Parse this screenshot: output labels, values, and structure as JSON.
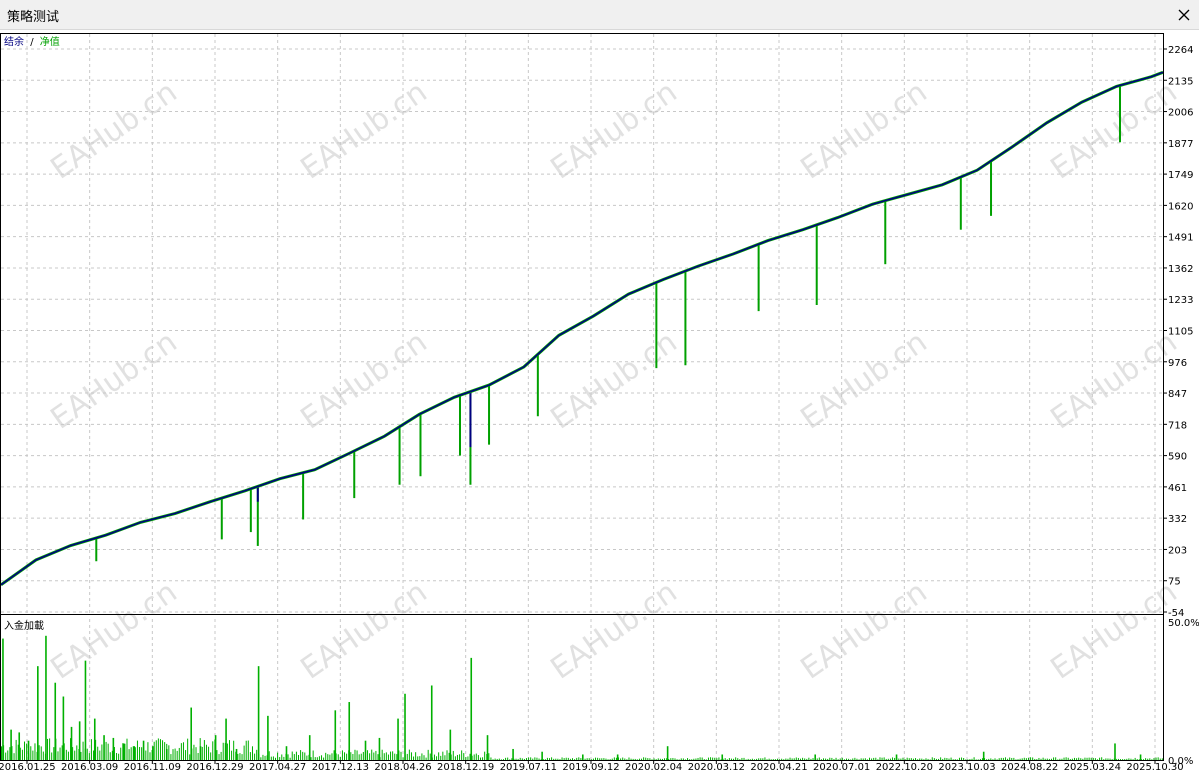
{
  "window": {
    "title": "策略测试",
    "close_icon": "close-icon"
  },
  "watermark": "EAHub.cn",
  "colors": {
    "balance": "#000080",
    "equity": "#00a000",
    "deposit_load": "#00b000",
    "grid": "#c8c8c8"
  },
  "chart_data": [
    {
      "type": "line",
      "legend": {
        "balance_label": "结余",
        "separator": "/",
        "equity_label": "净值"
      },
      "x_labels": [
        "2016.01.25",
        "2016.03.09",
        "2016.11.09",
        "2016.12.29",
        "2017.04.27",
        "2017.12.13",
        "2018.04.26",
        "2018.12.19",
        "2019.07.11",
        "2019.09.12",
        "2020.02.04",
        "2020.03.12",
        "2020.04.21",
        "2020.07.01",
        "2022.10.20",
        "2023.10.03",
        "2024.08.22",
        "2025.03.24",
        "2025.10.30"
      ],
      "y_ticks": [
        "2264",
        "2135",
        "2006",
        "1877",
        "1749",
        "1620",
        "1491",
        "1362",
        "1233",
        "1105",
        "976",
        "847",
        "718",
        "590",
        "461",
        "332",
        "203",
        "75",
        "-54"
      ],
      "ylim": [
        -54,
        2264
      ],
      "series": [
        {
          "x": [
            0,
            3,
            6,
            9,
            12,
            15,
            18,
            21,
            24,
            27,
            30,
            33,
            36,
            39,
            42,
            45,
            48,
            51,
            54,
            57,
            60,
            63,
            66,
            69,
            72,
            75,
            78,
            81,
            84,
            87,
            90,
            93,
            96,
            99,
            100
          ],
          "values": [
            58,
            160,
            220,
            262,
            315,
            352,
            400,
            445,
            495,
            532,
            600,
            670,
            760,
            830,
            880,
            955,
            1085,
            1165,
            1255,
            1315,
            1370,
            1420,
            1475,
            1520,
            1570,
            1625,
            1665,
            1705,
            1765,
            1860,
            1960,
            2045,
            2110,
            2150,
            2168
          ]
        }
      ],
      "equity_dips": [
        {
          "x": 8.2,
          "value": 155
        },
        {
          "x": 19,
          "value": 245
        },
        {
          "x": 21.5,
          "value": 275
        },
        {
          "x": 22.1,
          "value": 218
        },
        {
          "x": 26,
          "value": 327
        },
        {
          "x": 30.4,
          "value": 415
        },
        {
          "x": 34.3,
          "value": 470
        },
        {
          "x": 36.1,
          "value": 505
        },
        {
          "x": 39.5,
          "value": 590
        },
        {
          "x": 40.4,
          "value": 470
        },
        {
          "x": 42,
          "value": 635
        },
        {
          "x": 46.2,
          "value": 752
        },
        {
          "x": 56.4,
          "value": 950
        },
        {
          "x": 58.9,
          "value": 962
        },
        {
          "x": 65.2,
          "value": 1185
        },
        {
          "x": 70.2,
          "value": 1210
        },
        {
          "x": 76.1,
          "value": 1378
        },
        {
          "x": 82.6,
          "value": 1520
        },
        {
          "x": 85.2,
          "value": 1577
        },
        {
          "x": 96.3,
          "value": 1880
        }
      ],
      "equity_spikes": [
        {
          "x": 22.1,
          "value": 400
        },
        {
          "x": 40.4,
          "value": 625
        }
      ]
    },
    {
      "type": "bar",
      "title": "入金加載",
      "y_ticks": [
        "50.0%",
        "0.0%"
      ],
      "ylim": [
        0,
        50
      ],
      "spikes": [
        {
          "x": 0.1,
          "value": 44
        },
        {
          "x": 0.8,
          "value": 11
        },
        {
          "x": 1.5,
          "value": 10
        },
        {
          "x": 2.3,
          "value": 7
        },
        {
          "x": 3.1,
          "value": 34
        },
        {
          "x": 3.8,
          "value": 45
        },
        {
          "x": 4.6,
          "value": 28
        },
        {
          "x": 5.3,
          "value": 23
        },
        {
          "x": 6.0,
          "value": 12
        },
        {
          "x": 6.7,
          "value": 14
        },
        {
          "x": 7.2,
          "value": 36
        },
        {
          "x": 8.0,
          "value": 15
        },
        {
          "x": 8.8,
          "value": 9
        },
        {
          "x": 9.6,
          "value": 8
        },
        {
          "x": 10.5,
          "value": 6
        },
        {
          "x": 11.4,
          "value": 5
        },
        {
          "x": 12.2,
          "value": 7
        },
        {
          "x": 13.0,
          "value": 5
        },
        {
          "x": 14.2,
          "value": 4
        },
        {
          "x": 16.3,
          "value": 19
        },
        {
          "x": 17.1,
          "value": 5
        },
        {
          "x": 18.4,
          "value": 9
        },
        {
          "x": 19.3,
          "value": 15
        },
        {
          "x": 20.2,
          "value": 4
        },
        {
          "x": 22.1,
          "value": 34
        },
        {
          "x": 22.9,
          "value": 16
        },
        {
          "x": 24.5,
          "value": 5
        },
        {
          "x": 26.5,
          "value": 9
        },
        {
          "x": 28.7,
          "value": 18
        },
        {
          "x": 29.9,
          "value": 21
        },
        {
          "x": 31.3,
          "value": 7
        },
        {
          "x": 32.5,
          "value": 8
        },
        {
          "x": 34.1,
          "value": 15
        },
        {
          "x": 34.7,
          "value": 24
        },
        {
          "x": 37.0,
          "value": 27
        },
        {
          "x": 38.6,
          "value": 11
        },
        {
          "x": 40.4,
          "value": 37
        },
        {
          "x": 41.8,
          "value": 9
        },
        {
          "x": 44.0,
          "value": 4
        },
        {
          "x": 46.5,
          "value": 3
        },
        {
          "x": 50.0,
          "value": 2
        },
        {
          "x": 53.0,
          "value": 2
        },
        {
          "x": 57.3,
          "value": 5
        },
        {
          "x": 62.0,
          "value": 2
        },
        {
          "x": 70.0,
          "value": 2
        },
        {
          "x": 77.0,
          "value": 2
        },
        {
          "x": 84.5,
          "value": 3
        },
        {
          "x": 95.8,
          "value": 6
        },
        {
          "x": 98.0,
          "value": 2
        }
      ]
    }
  ]
}
